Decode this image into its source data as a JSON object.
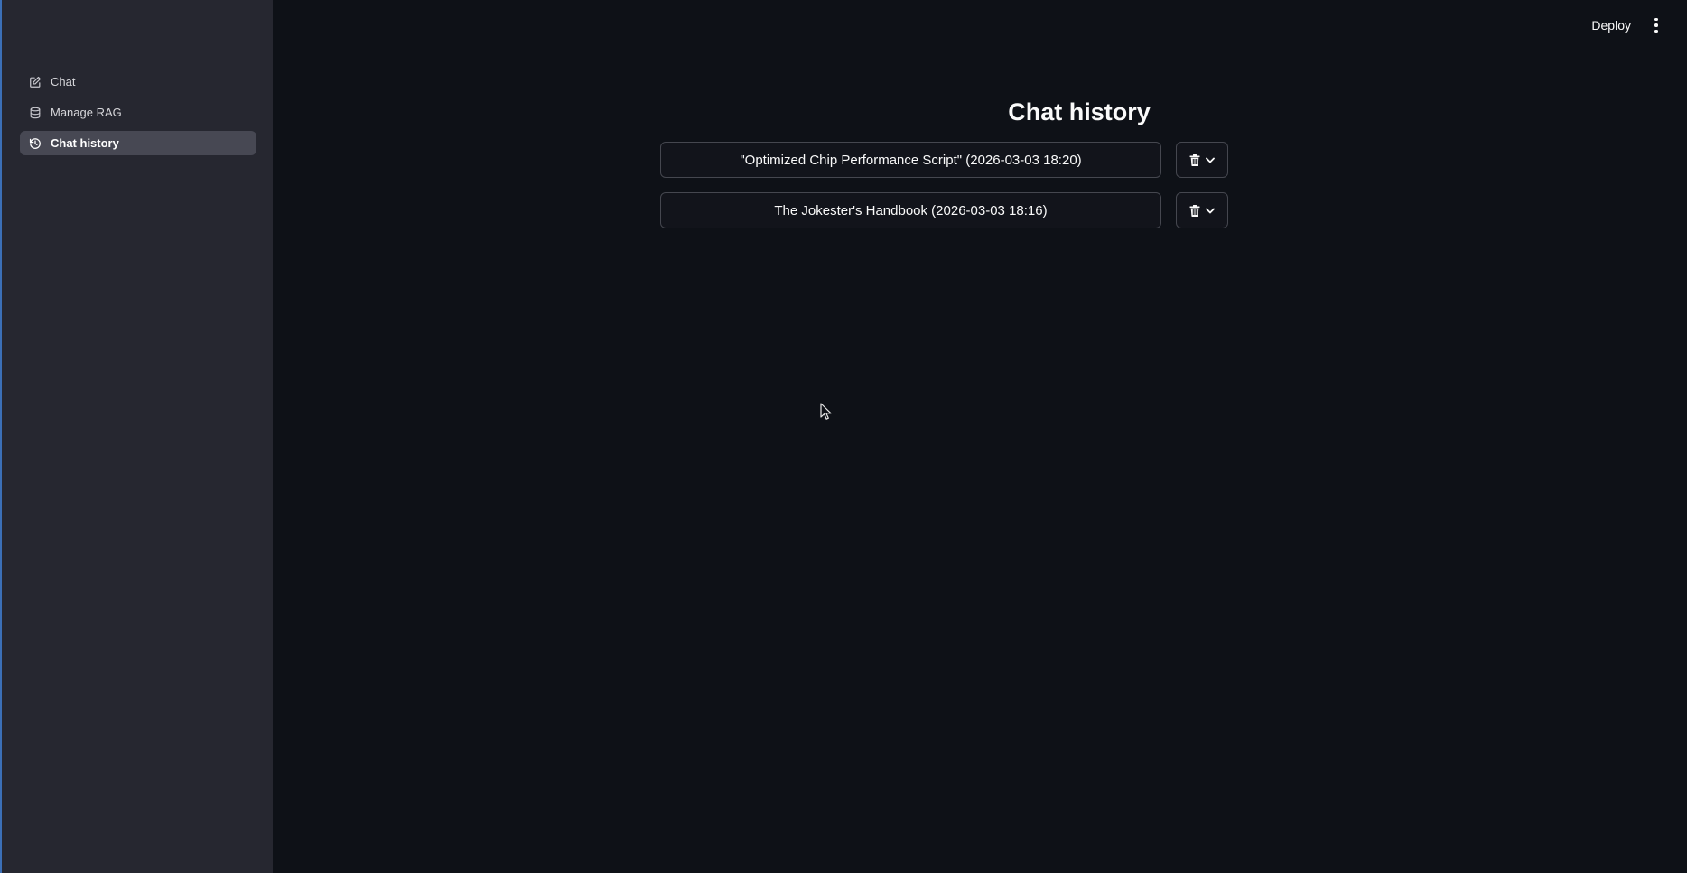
{
  "sidebar": {
    "items": [
      {
        "label": "Chat",
        "icon": "edit-icon",
        "active": false
      },
      {
        "label": "Manage RAG",
        "icon": "database-icon",
        "active": false
      },
      {
        "label": "Chat history",
        "icon": "history-icon",
        "active": true
      }
    ]
  },
  "header": {
    "deploy_label": "Deploy",
    "menu_icon": "kebab-menu-icon"
  },
  "main": {
    "title": "Chat history",
    "history": [
      {
        "label": "\"Optimized Chip Performance Script\" (2026-03-03 18:20)",
        "action_icons": [
          "trash-icon",
          "chevron-down-icon"
        ]
      },
      {
        "label": "The Jokester's Handbook (2026-03-03 18:16)",
        "action_icons": [
          "trash-icon",
          "chevron-down-icon"
        ]
      }
    ]
  },
  "colors": {
    "background": "#0e1117",
    "sidebar": "#262730",
    "active_item": "#474853",
    "text": "#fafafa",
    "border": "#45474f"
  }
}
